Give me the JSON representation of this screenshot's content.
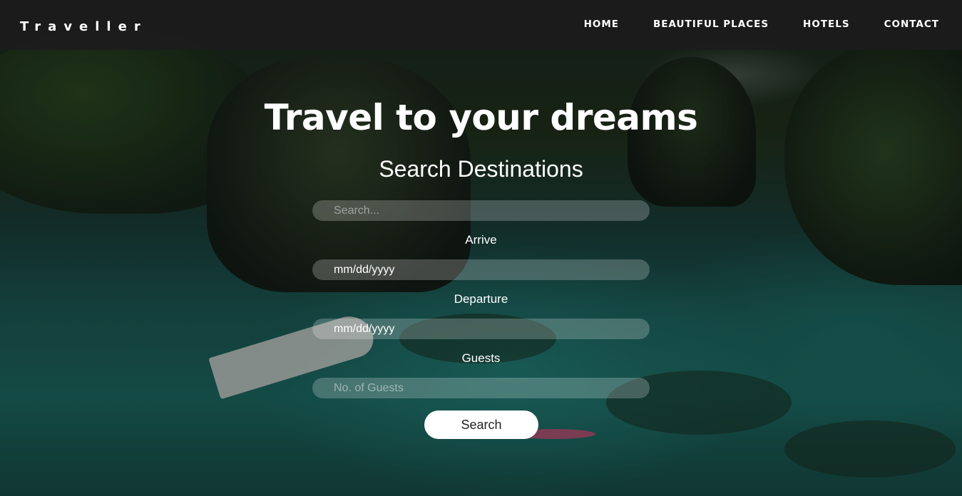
{
  "brand": {
    "name": "Traveller"
  },
  "nav": {
    "items": [
      {
        "label": "HOME"
      },
      {
        "label": "BEAUTIFUL PLACES"
      },
      {
        "label": "HOTELS"
      },
      {
        "label": "CONTACT"
      }
    ]
  },
  "hero": {
    "title": "Travel to your dreams",
    "subtitle": "Search Destinations"
  },
  "form": {
    "search": {
      "placeholder": "Search...",
      "value": ""
    },
    "arrive": {
      "label": "Arrive",
      "value": "mm/dd/yyyy"
    },
    "departure": {
      "label": "Departure",
      "value": "mm/dd/yyyy"
    },
    "guests": {
      "label": "Guests",
      "placeholder": "No. of Guests",
      "value": ""
    },
    "submit_label": "Search"
  }
}
